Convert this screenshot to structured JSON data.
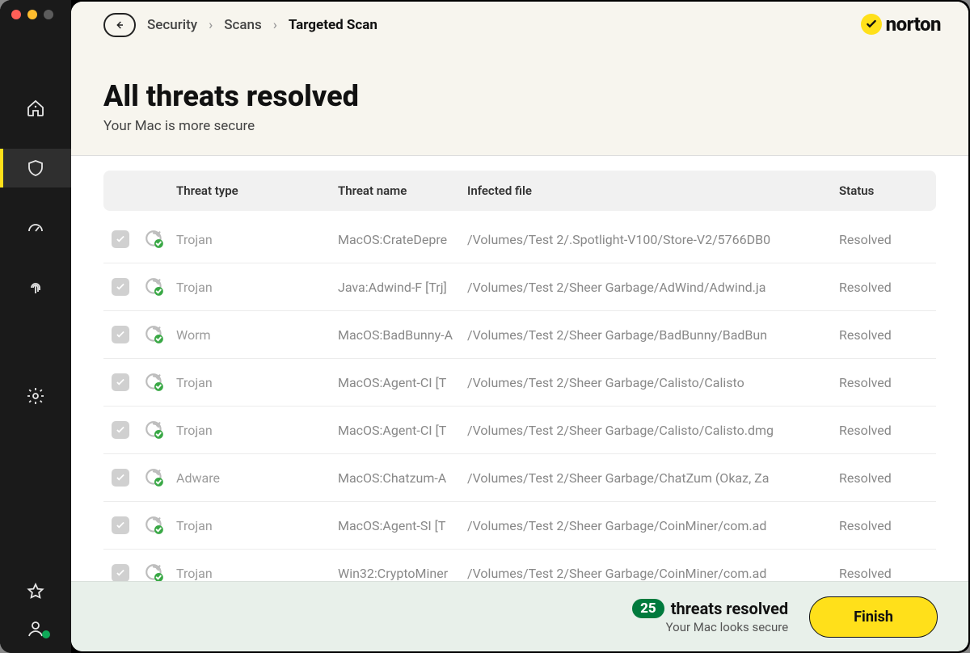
{
  "breadcrumb": {
    "items": [
      "Security",
      "Scans",
      "Targeted Scan"
    ],
    "active_index": 2
  },
  "brand": "norton",
  "heading": {
    "title": "All threats resolved",
    "subtitle": "Your Mac is more secure"
  },
  "table": {
    "columns": [
      "",
      "Threat type",
      "Threat name",
      "Infected file",
      "Status"
    ],
    "rows": [
      {
        "type": "Trojan",
        "name": "MacOS:CrateDepre",
        "file": "/Volumes/Test 2/.Spotlight-V100/Store-V2/5766DB0",
        "status": "Resolved"
      },
      {
        "type": "Trojan",
        "name": "Java:Adwind-F [Trj]",
        "file": "/Volumes/Test 2/Sheer Garbage/AdWind/Adwind.ja",
        "status": "Resolved"
      },
      {
        "type": "Worm",
        "name": "MacOS:BadBunny-A",
        "file": "/Volumes/Test 2/Sheer Garbage/BadBunny/BadBun",
        "status": "Resolved"
      },
      {
        "type": "Trojan",
        "name": "MacOS:Agent-CI [T",
        "file": "/Volumes/Test 2/Sheer Garbage/Calisto/Calisto",
        "status": "Resolved"
      },
      {
        "type": "Trojan",
        "name": "MacOS:Agent-CI [T",
        "file": "/Volumes/Test 2/Sheer Garbage/Calisto/Calisto.dmg",
        "status": "Resolved"
      },
      {
        "type": "Adware",
        "name": "MacOS:Chatzum-A",
        "file": "/Volumes/Test 2/Sheer Garbage/ChatZum (Okaz, Za",
        "status": "Resolved"
      },
      {
        "type": "Trojan",
        "name": "MacOS:Agent-SI [T",
        "file": "/Volumes/Test 2/Sheer Garbage/CoinMiner/com.ad",
        "status": "Resolved"
      },
      {
        "type": "Trojan",
        "name": "Win32:CryptoMiner",
        "file": "/Volumes/Test 2/Sheer Garbage/CoinMiner/com.ad",
        "status": "Resolved"
      }
    ]
  },
  "footer": {
    "count": "25",
    "count_label": "threats resolved",
    "subtitle": "Your Mac looks secure",
    "finish_label": "Finish"
  }
}
